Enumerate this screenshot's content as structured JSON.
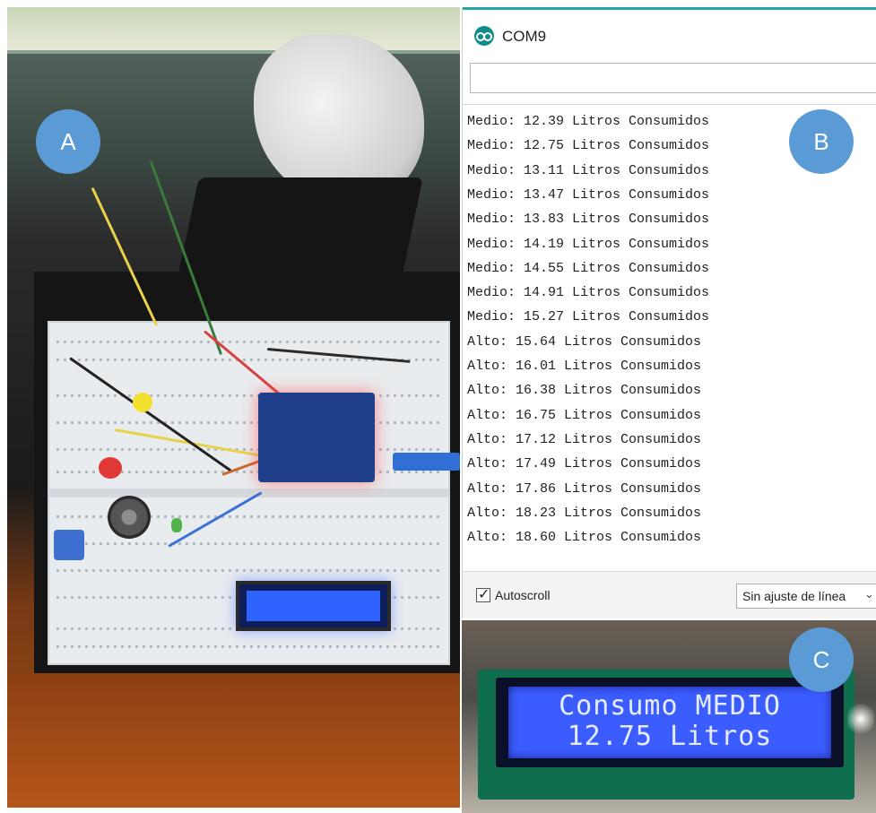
{
  "serial_monitor": {
    "title": "COM9",
    "input_value": "",
    "output_lines": [
      "Medio: 12.39 Litros Consumidos",
      "Medio: 12.75 Litros Consumidos",
      "Medio: 13.11 Litros Consumidos",
      "Medio: 13.47 Litros Consumidos",
      "Medio: 13.83 Litros Consumidos",
      "Medio: 14.19 Litros Consumidos",
      "Medio: 14.55 Litros Consumidos",
      "Medio: 14.91 Litros Consumidos",
      "Medio: 15.27 Litros Consumidos",
      "Alto: 15.64 Litros Consumidos",
      "Alto: 16.01 Litros Consumidos",
      "Alto: 16.38 Litros Consumidos",
      "Alto: 16.75 Litros Consumidos",
      "Alto: 17.12 Litros Consumidos",
      "Alto: 17.49 Litros Consumidos",
      "Alto: 17.86 Litros Consumidos",
      "Alto: 18.23 Litros Consumidos",
      "Alto: 18.60 Litros Consumidos"
    ],
    "autoscroll_label": "Autoscroll",
    "autoscroll_checked": true,
    "line_ending": "Sin ajuste de línea",
    "app_icon": "arduino-icon"
  },
  "lcd_closeup": {
    "line1": "Consumo MEDIO",
    "line2": "12.75 Litros"
  },
  "badges": {
    "a": "A",
    "b": "B",
    "c": "C"
  },
  "colors": {
    "badge": "#5b9bd5",
    "lcd_screen": "#3b5cff",
    "window_accent": "#0f8c8c"
  }
}
